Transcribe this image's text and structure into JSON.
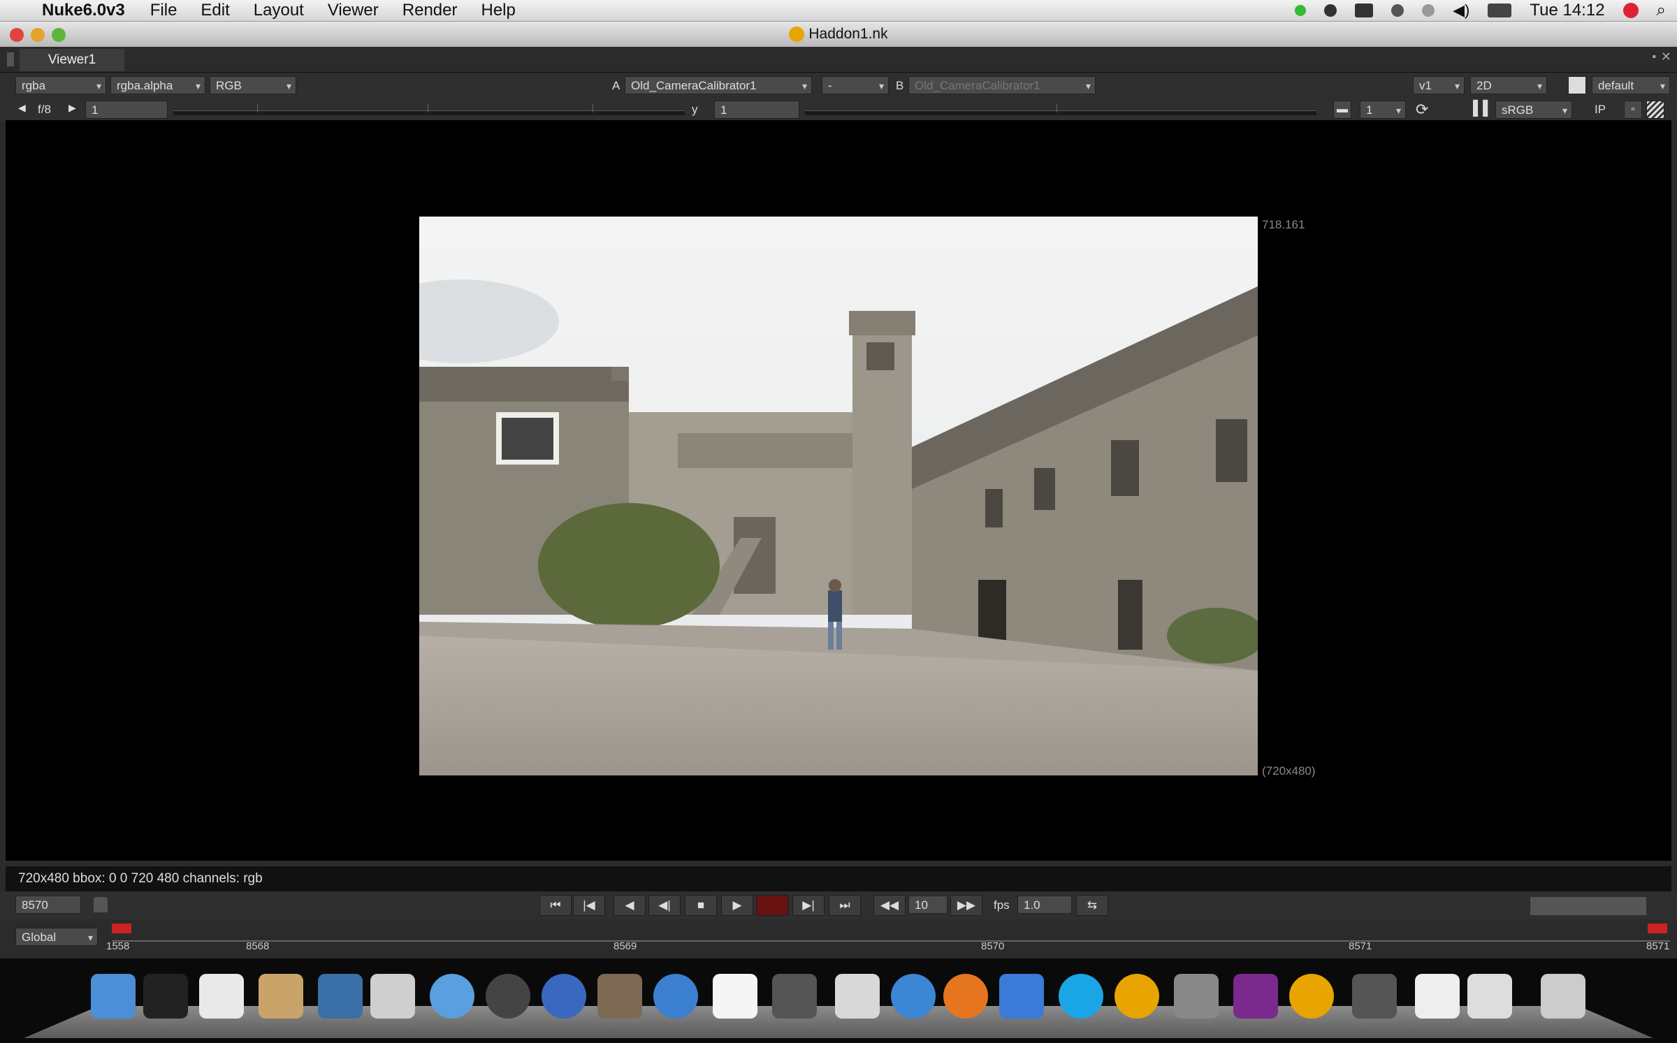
{
  "menubar": {
    "app_name": "Nuke6.0v3",
    "items": [
      "File",
      "Edit",
      "Layout",
      "Viewer",
      "Render",
      "Help"
    ],
    "clock": "Tue 14:12"
  },
  "window": {
    "title": "Haddon1.nk"
  },
  "viewer": {
    "tab_label": "Viewer1",
    "channels": "rgba",
    "alpha_channel": "rgba.alpha",
    "display": "RGB",
    "a_label": "A",
    "input_a": "Old_CameraCalibrator1",
    "operation": "-",
    "b_label": "B",
    "input_b": "Old_CameraCalibrator1",
    "view": "v1",
    "mode": "2D",
    "lut_preset": "default",
    "fstop": "f/8",
    "gain": "1",
    "y_label": "y",
    "gamma": "1",
    "proxy_level": "1",
    "colorspace": "sRGB",
    "ip_label": "IP",
    "format_label": "718.161",
    "resolution_label": "(720x480)",
    "info_text": "720x480 bbox: 0 0 720 480 channels: rgb"
  },
  "playback": {
    "current_frame": "8570",
    "increment": "10",
    "fps_label": "fps",
    "fps": "1.0"
  },
  "timeline": {
    "mode": "Global",
    "labels": [
      "1558",
      "8568",
      "8569",
      "8570",
      "8571",
      "8571"
    ]
  },
  "dock": {
    "icons": [
      "finder",
      "terminal",
      "ical",
      "archive",
      "iphoto",
      "preview",
      "itunes",
      "time-machine",
      "safari-compass",
      "gimp",
      "mail",
      "textedit",
      "dashboard",
      "calculator",
      "network",
      "firefox",
      "xcode",
      "skype",
      "nuke",
      "system-preferences",
      "hd-app",
      "nuke",
      "folder",
      "document",
      "downloads",
      "trash"
    ]
  }
}
